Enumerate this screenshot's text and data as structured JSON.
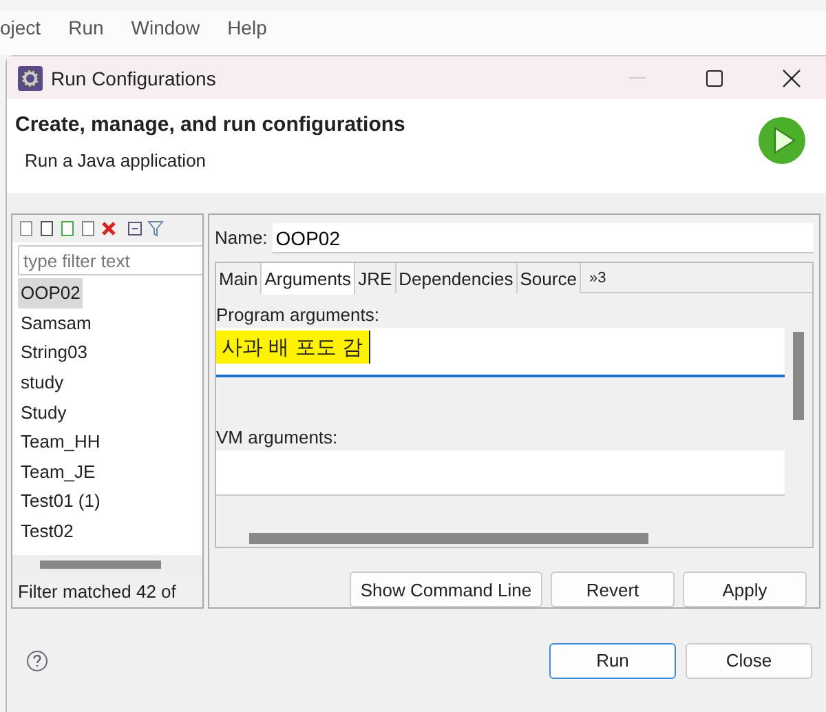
{
  "menu_bar": [
    "oject",
    "Run",
    "Window",
    "Help"
  ],
  "window": {
    "title": "Run Configurations"
  },
  "header": {
    "title": "Create, manage, and run configurations",
    "subtitle": "Run a Java application"
  },
  "left_panel": {
    "filter": {
      "placeholder": "type filter text"
    },
    "items": [
      {
        "label": "OOP02",
        "selected": true
      },
      {
        "label": "Samsam",
        "selected": false
      },
      {
        "label": "String03",
        "selected": false
      },
      {
        "label": "study",
        "selected": false
      },
      {
        "label": "Study",
        "selected": false
      },
      {
        "label": "Team_HH",
        "selected": false
      },
      {
        "label": "Team_JE",
        "selected": false
      },
      {
        "label": "Test01 (1)",
        "selected": false
      },
      {
        "label": "Test02",
        "selected": false
      }
    ],
    "status": "Filter matched 42 of"
  },
  "editor": {
    "name_label": "Name:",
    "name_value": "OOP02",
    "tabs": [
      {
        "label": "Main",
        "selected": false
      },
      {
        "label": "Arguments",
        "selected": true
      },
      {
        "label": "JRE",
        "selected": false
      },
      {
        "label": "Dependencies",
        "selected": false
      },
      {
        "label": "Source",
        "selected": false
      }
    ],
    "more_tabs": "»3",
    "program_arguments": {
      "label": "Program arguments:",
      "value": "사과 배 포도 감",
      "highlighted": true
    },
    "vm_arguments": {
      "label": "VM arguments:"
    },
    "buttons": [
      "Show Command Line",
      "Revert",
      "Apply"
    ]
  },
  "footer_buttons": [
    {
      "label": "Run",
      "default": true
    },
    {
      "label": "Close",
      "default": false
    }
  ]
}
